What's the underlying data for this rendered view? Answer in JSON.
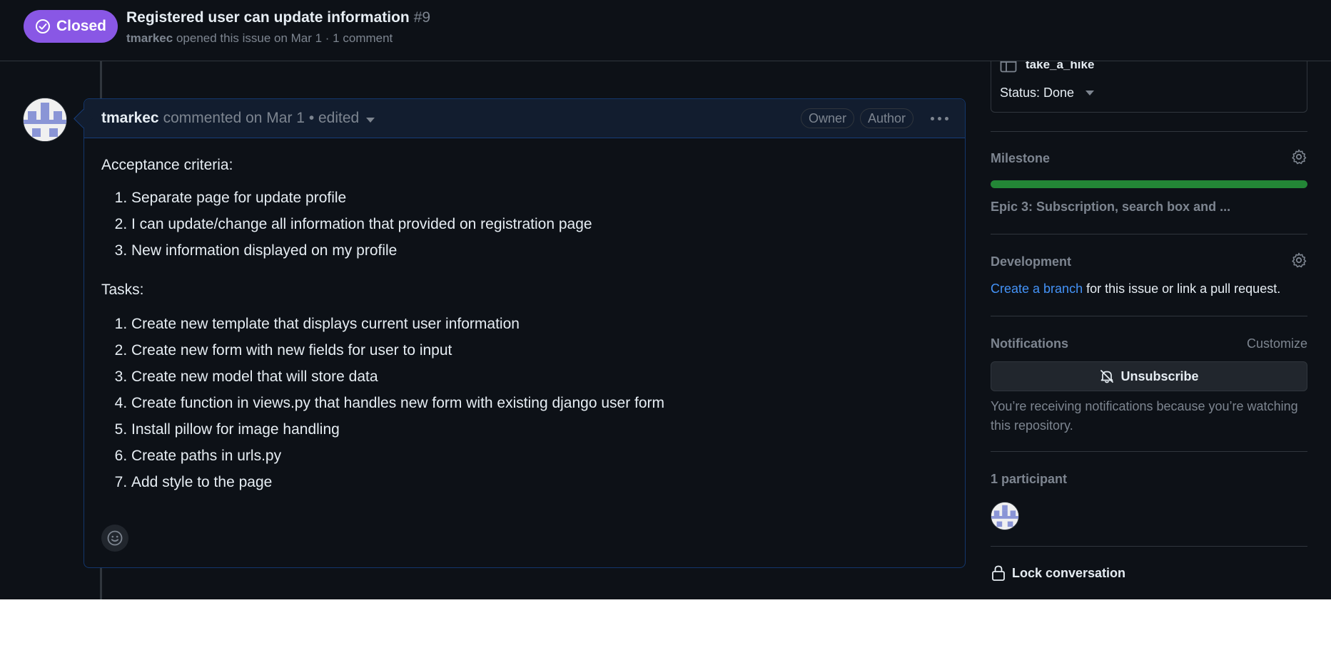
{
  "header": {
    "state_label": "Closed",
    "title": "Registered user can update information",
    "number": "#9",
    "author": "tmarkec",
    "meta_text": "opened this issue on Mar 1 · 1 comment"
  },
  "comment": {
    "author": "tmarkec",
    "meta": "commented on Mar 1 • edited",
    "badges": [
      "Owner",
      "Author"
    ],
    "intro": "Acceptance criteria:",
    "criteria": [
      "Separate page for update profile",
      "I can update/change all information that provided on registration page",
      "New information displayed on my profile"
    ],
    "tasks_heading": "Tasks:",
    "tasks": [
      "Create new template that displays current user information",
      "Create new form with new fields for user to input",
      "Create new model that will store data",
      "Create function in views.py that handles new form with existing django user form",
      "Install pillow for image handling",
      "Create paths in urls.py",
      "Add style to the page"
    ]
  },
  "sidebar": {
    "project": {
      "name": "take_a_hike",
      "status": "Status: Done"
    },
    "milestone": {
      "heading": "Milestone",
      "progress_percent": 100,
      "title": "Epic 3: Subscription, search box and ..."
    },
    "development": {
      "heading": "Development",
      "link_text": "Create a branch",
      "text": " for this issue or link a pull request."
    },
    "notifications": {
      "heading": "Notifications",
      "customize": "Customize",
      "button_label": "Unsubscribe",
      "description": "You’re receiving notifications because you’re watching this repository."
    },
    "participants": {
      "heading": "1 participant"
    },
    "lock": {
      "label": "Lock conversation"
    }
  },
  "colors": {
    "closed_badge": "#8957e5",
    "progress": "#238636",
    "link": "#4493f8",
    "background": "#0d1117"
  }
}
